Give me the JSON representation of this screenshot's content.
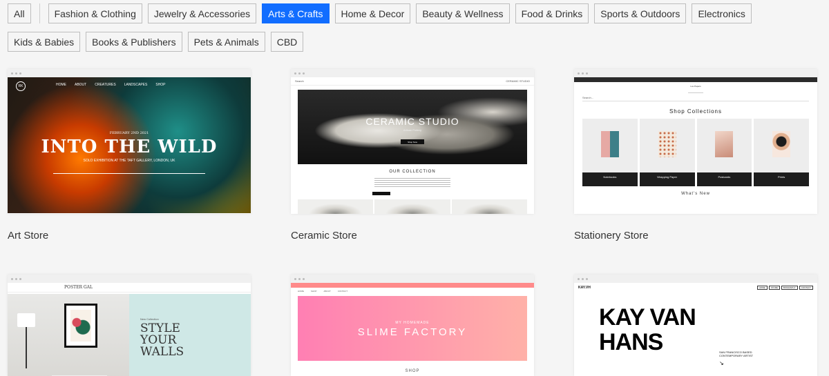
{
  "filters": {
    "row1": [
      {
        "label": "All",
        "active": false
      },
      {
        "label": "Fashion & Clothing",
        "active": false
      },
      {
        "label": "Jewelry & Accessories",
        "active": false
      },
      {
        "label": "Arts & Crafts",
        "active": true
      },
      {
        "label": "Home & Decor",
        "active": false
      },
      {
        "label": "Beauty & Wellness",
        "active": false
      },
      {
        "label": "Food & Drinks",
        "active": false
      },
      {
        "label": "Sports & Outdoors",
        "active": false
      },
      {
        "label": "Electronics",
        "active": false
      }
    ],
    "row2": [
      {
        "label": "Kids & Babies"
      },
      {
        "label": "Books & Publishers"
      },
      {
        "label": "Pets & Animals"
      },
      {
        "label": "CBD"
      }
    ]
  },
  "accent_color": "#116dff",
  "templates": {
    "art": {
      "title": "Art Store",
      "logo": "RK",
      "nav": [
        "HOME",
        "ABOUT",
        "CREATURES",
        "LANDSCAPES",
        "SHOP"
      ],
      "date": "FEBRUARY 2ND 2021",
      "headline": "INTO THE WILD",
      "sub": "SOLO EXHIBITION AT THE TAFT GALLERY, LONDON, UK"
    },
    "ceramic": {
      "title": "Ceramic Store",
      "brand": "CERAMIC STUDIO",
      "search": "Search",
      "headline": "CERAMIC STUDIO",
      "sub": "Artisan Pottery",
      "button": "Shop Now",
      "collection": "OUR COLLECTION"
    },
    "stationery": {
      "title": "Stationery Store",
      "brand": "Lou Papers",
      "search": "Search...",
      "heading": "Shop Collections",
      "items": [
        "Notebooks",
        "Wrapping Paper",
        "Postcards",
        "Prints"
      ],
      "whats_new": "What's New"
    },
    "poster": {
      "brand": "POSTER GAL",
      "small": "New Collection",
      "headline": "STYLE YOUR WALLS"
    },
    "slime": {
      "nav": [
        "HOME",
        "SHOP",
        "ABOUT",
        "CONTACT"
      ],
      "sub": "MY HOMEMADE",
      "headline": "SLIME FACTORY",
      "shop": "SHOP"
    },
    "kay": {
      "logo": "KAY.VH",
      "links": [
        "HOME",
        "STORE",
        "BIOGRAPHY",
        "CONTACT"
      ],
      "name_line1": "KAY VAN",
      "name_line2": "HANS",
      "desc_line1": "SAN FRANCISCO BASED",
      "desc_line2": "CONTEMPORARY ARTIST"
    }
  }
}
